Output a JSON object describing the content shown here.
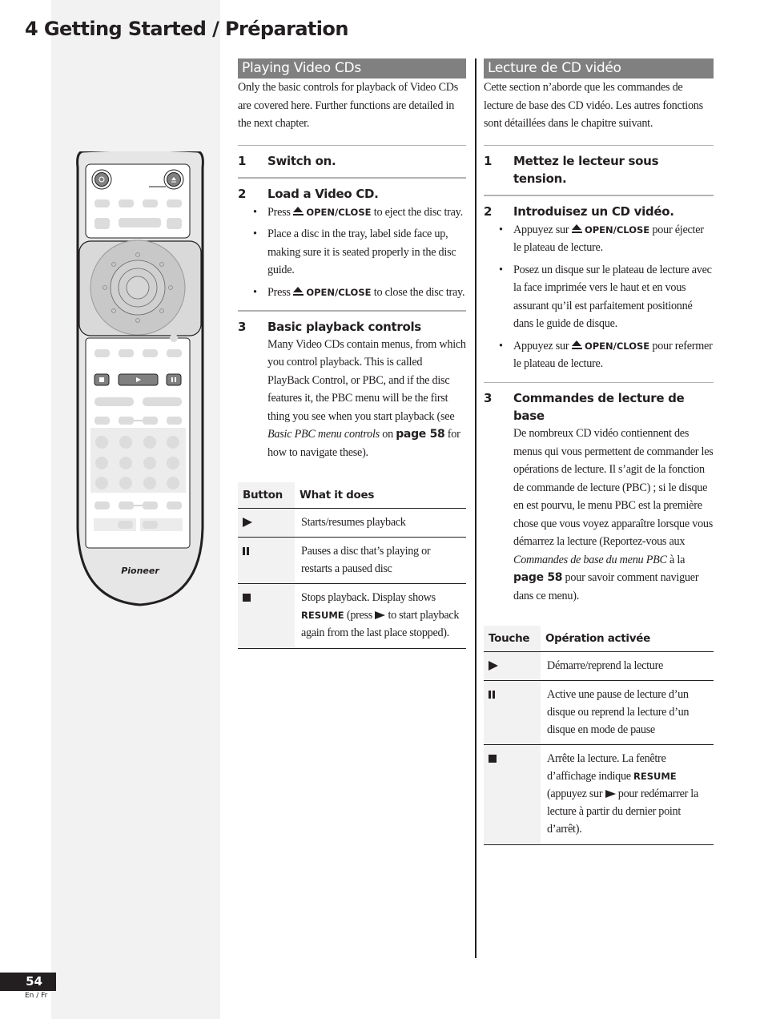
{
  "chapter_title": "4 Getting Started / Préparation",
  "footer": {
    "page_number": "54",
    "language": "En / Fr"
  },
  "remote": {
    "brand": "Pioneer",
    "icons": [
      "power-icon",
      "eject-icon",
      "stop-icon",
      "play-icon",
      "pause-icon"
    ]
  },
  "en": {
    "section_title": "Playing Video CDs",
    "intro": "Only the basic controls for playback of Video CDs are covered here. Further functions are detailed in the next chapter.",
    "steps": [
      {
        "num": "1",
        "title": "Switch on."
      },
      {
        "num": "2",
        "title": "Load a Video CD."
      },
      {
        "num": "3",
        "title": "Basic playback controls"
      }
    ],
    "bullets": [
      {
        "pre": "Press",
        "key": "OPEN/CLOSE",
        "post": "to eject the disc tray."
      },
      {
        "text": "Place a disc in the tray, label side face up, making sure it is seated properly in the disc guide."
      },
      {
        "pre": "Press",
        "key": "OPEN/CLOSE",
        "post": "to close the disc tray."
      }
    ],
    "step3_body": {
      "text": "Many Video CDs contain menus, from which you control playback. This is called PlayBack Control, or PBC, and if the disc features it, the PBC menu will be the first thing you see when you start playback (see",
      "italic": "Basic PBC menu controls",
      "on": "on",
      "page_ref": "page 58",
      "tail": "for how to navigate these)."
    },
    "table": {
      "headers": [
        "Button",
        "What it does"
      ],
      "rows": [
        {
          "icon": "play-icon",
          "desc": "Starts/resumes playback"
        },
        {
          "icon": "pause-icon",
          "desc": "Pauses a disc that’s playing or restarts a paused disc"
        },
        {
          "icon": "stop-icon",
          "desc_pre": "Stops playback. Display shows",
          "key": "RESUME",
          "desc_mid": "(press",
          "desc_post": "to start playback again from the last place stopped)."
        }
      ]
    }
  },
  "fr": {
    "section_title": "Lecture de CD vidéo",
    "intro": "Cette section n’aborde que les commandes de lecture de base des CD vidéo. Les autres fonctions sont détaillées dans le chapitre suivant.",
    "steps": [
      {
        "num": "1",
        "title": "Mettez le lecteur sous tension."
      },
      {
        "num": "2",
        "title": "Introduisez un CD vidéo."
      },
      {
        "num": "3",
        "title": "Commandes de lecture de base"
      }
    ],
    "bullets": [
      {
        "pre": "Appuyez sur",
        "key": "OPEN/CLOSE",
        "post": "pour éjecter le plateau de lecture."
      },
      {
        "text": "Posez un disque sur le plateau de lecture avec la face imprimée vers le haut et en vous assurant qu’il est parfaitement positionné dans le guide de disque."
      },
      {
        "pre": "Appuyez sur",
        "key": "OPEN/CLOSE",
        "post": "pour refermer le plateau de lecture."
      }
    ],
    "step3_body": {
      "text": "De nombreux CD vidéo contiennent des menus qui vous permettent de commander les opérations de lecture. Il s’agit de la fonction de commande de lecture (PBC) ; si le disque en est pourvu, le menu PBC est la première chose que vous voyez apparaître lorsque vous démarrez la lecture (Reportez-vous aux",
      "italic": "Commandes de base du menu PBC",
      "on": "à la",
      "page_ref": "page 58",
      "tail": "pour savoir comment naviguer dans ce menu)."
    },
    "table": {
      "headers": [
        "Touche",
        "Opération activée"
      ],
      "rows": [
        {
          "icon": "play-icon",
          "desc": "Démarre/reprend la lecture"
        },
        {
          "icon": "pause-icon",
          "desc": "Active une pause de lecture d’un disque ou reprend la lecture d’un disque en mode de pause"
        },
        {
          "icon": "stop-icon",
          "desc_pre": "Arrête la lecture. La fenêtre d’affichage indique",
          "key": "RESUME",
          "desc_mid": "(appuyez sur",
          "desc_post": "pour redémarrer la lecture à partir du dernier point d’arrêt)."
        }
      ]
    }
  }
}
